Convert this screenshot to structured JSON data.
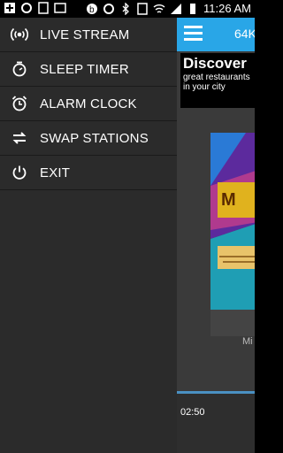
{
  "status_bar": {
    "time": "11:26 AM",
    "icons": [
      "add-icon",
      "sync-icon",
      "email-icon",
      "gallery-icon",
      "beats-icon",
      "sync-icon",
      "bluetooth-icon",
      "nfc-icon",
      "wifi-icon",
      "lte-icon",
      "signal-icon",
      "battery-icon"
    ]
  },
  "drawer": {
    "items": [
      {
        "label": "LIVE STREAM",
        "icon": "broadcast-icon"
      },
      {
        "label": "SLEEP TIMER",
        "icon": "timer-icon"
      },
      {
        "label": "ALARM CLOCK",
        "icon": "alarm-icon"
      },
      {
        "label": "SWAP STATIONS",
        "icon": "swap-icon"
      },
      {
        "label": "EXIT",
        "icon": "power-icon"
      }
    ]
  },
  "main": {
    "bitrate": "64K",
    "ad": {
      "title": "Discover",
      "subtitle": "great restaurants in your city"
    },
    "station_partial": "Mi",
    "elapsed": "02:50"
  },
  "colors": {
    "accent": "#29a6e7",
    "drawer_bg": "#2b2b2b",
    "progress": "#4a90c2"
  }
}
